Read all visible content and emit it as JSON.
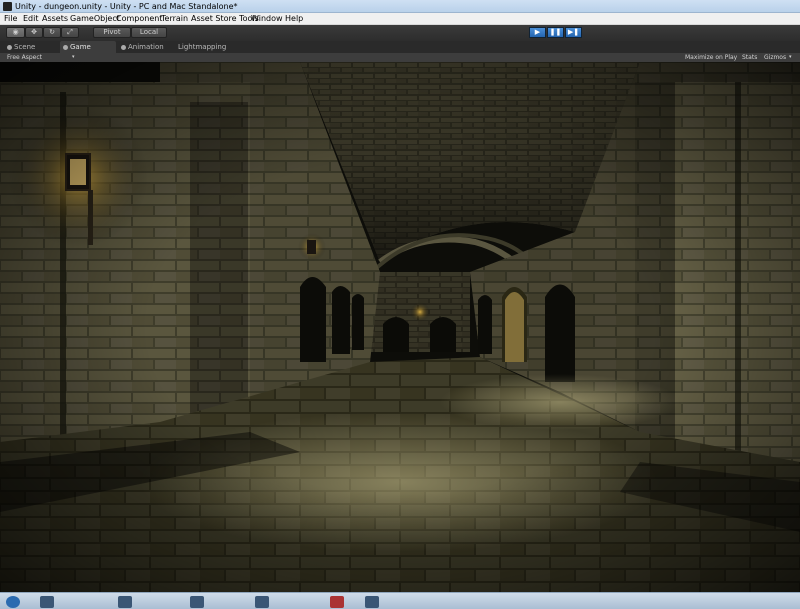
{
  "window": {
    "title": "Unity - dungeon.unity - Unity - PC and Mac Standalone*"
  },
  "menu": {
    "items": [
      "File",
      "Edit",
      "Assets",
      "GameObject",
      "Component",
      "Terrain",
      "Asset Store Tools",
      "Window",
      "Help"
    ]
  },
  "toolbar": {
    "pivot_label": "Pivot",
    "local_label": "Local",
    "play_label": "▶",
    "pause_label": "❚❚",
    "step_label": "▶❚"
  },
  "tabs": {
    "scene": "Scene",
    "game": "Game",
    "animation": "Animation",
    "lightmapping": "Lightmapping"
  },
  "game_view": {
    "aspect": "Free Aspect",
    "maximize_on_play": "Maximize on Play",
    "stats": "Stats",
    "gizmos": "Gizmos"
  },
  "colors": {
    "play_blue": "#2f78c8",
    "stone": "#55513a",
    "torch": "#f2c24a"
  }
}
